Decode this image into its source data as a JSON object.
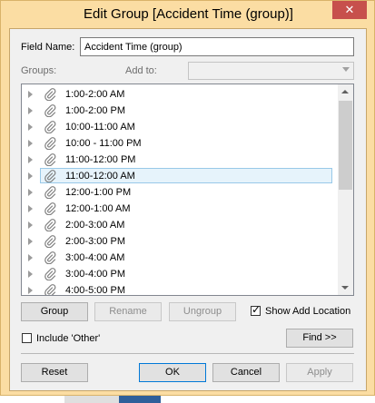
{
  "dialog": {
    "title": "Edit Group [Accident Time (group)]",
    "close_glyph": "✕"
  },
  "field_name": {
    "label": "Field Name:",
    "value": "Accident Time (group)"
  },
  "groups_label": "Groups:",
  "add_to": {
    "label": "Add to:",
    "value": ""
  },
  "items": [
    "1:00-2:00 AM",
    "1:00-2:00 PM",
    "10:00-11:00 AM",
    "10:00 - 11:00 PM",
    "11:00-12:00 PM",
    "11:00-12:00 AM",
    "12:00-1:00 PM",
    "12:00-1:00 AM",
    "2:00-3:00 AM",
    "2:00-3:00 PM",
    "3:00-4:00 AM",
    "3:00-4:00 PM",
    "4:00-5:00 PM"
  ],
  "selected_item": "11:00-12:00 AM",
  "buttons": {
    "group": "Group",
    "rename": "Rename",
    "ungroup": "Ungroup",
    "find": "Find >>",
    "reset": "Reset",
    "ok": "OK",
    "cancel": "Cancel",
    "apply": "Apply"
  },
  "checkboxes": {
    "show_add_location": {
      "label": "Show Add Location",
      "checked": true,
      "mark": "✓"
    },
    "include_other": {
      "label": "Include 'Other'",
      "checked": false
    }
  },
  "colors": {
    "frame": "#fbdda3",
    "close": "#c7504c",
    "selection": "#e6f3fb",
    "selection_border": "#99c9e8"
  }
}
